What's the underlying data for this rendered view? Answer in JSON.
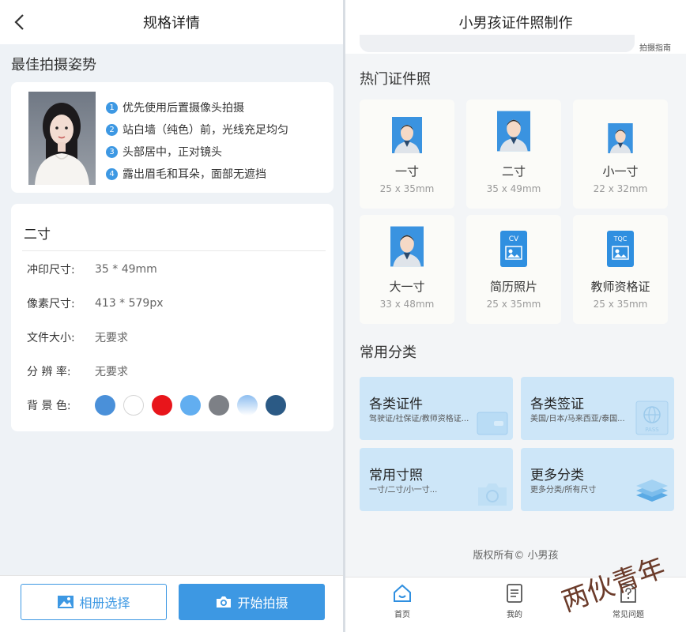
{
  "left": {
    "header_title": "规格详情",
    "section_title": "最佳拍摄姿势",
    "tips": [
      {
        "num": "1",
        "text": "优先使用后置摄像头拍摄"
      },
      {
        "num": "2",
        "text": "站白墙（纯色）前，光线充足均匀"
      },
      {
        "num": "3",
        "text": "头部居中，正对镜头"
      },
      {
        "num": "4",
        "text": "露出眉毛和耳朵，面部无遮挡"
      }
    ],
    "spec": {
      "name": "二寸",
      "print_label": "冲印尺寸:",
      "print_value": "35 * 49mm",
      "pixel_label": "像素尺寸:",
      "pixel_value": "413 * 579px",
      "filesize_label": "文件大小:",
      "filesize_value": "无要求",
      "resolution_label": "分 辨 率:",
      "resolution_value": "无要求",
      "bg_label": "背 景 色:",
      "bg_colors": [
        "#4a90d9",
        "#ffffff",
        "#e8151b",
        "#62aef0",
        "#7d8086",
        "#8dbef0",
        "#2b5a85"
      ]
    },
    "album_button": "相册选择",
    "shoot_button": "开始拍摄"
  },
  "right": {
    "header_title": "小男孩证件照制作",
    "guide_text": "拍摄指南",
    "hot_title": "热门证件照",
    "photos": [
      {
        "name": "一寸",
        "size": "25 x 35mm"
      },
      {
        "name": "二寸",
        "size": "35 x 49mm"
      },
      {
        "name": "小一寸",
        "size": "22 x 32mm"
      },
      {
        "name": "大一寸",
        "size": "33 x 48mm"
      },
      {
        "name": "简历照片",
        "size": "25 x 35mm"
      },
      {
        "name": "教师资格证",
        "size": "25 x 35mm"
      }
    ],
    "cv_badge": "CV",
    "tqc_badge": "TQC",
    "common_title": "常用分类",
    "categories": [
      {
        "title": "各类证件",
        "sub": "驾驶证/社保证/教师资格证..."
      },
      {
        "title": "各类签证",
        "sub": "美国/日本/马来西亚/泰国..."
      },
      {
        "title": "常用寸照",
        "sub": "一寸/二寸/小一寸..."
      },
      {
        "title": "更多分类",
        "sub": "更多分类/所有尺寸"
      }
    ],
    "pass_text": "PASS",
    "copyright": "版权所有© 小男孩",
    "tabs": [
      {
        "label": "首页",
        "icon": "home-icon"
      },
      {
        "label": "我的",
        "icon": "document-icon"
      },
      {
        "label": "常见问题",
        "icon": "question-icon"
      }
    ]
  },
  "watermark_text": "两伙青年",
  "colors": {
    "accent": "#3d98e3",
    "category_bg": "#cde6f8"
  }
}
